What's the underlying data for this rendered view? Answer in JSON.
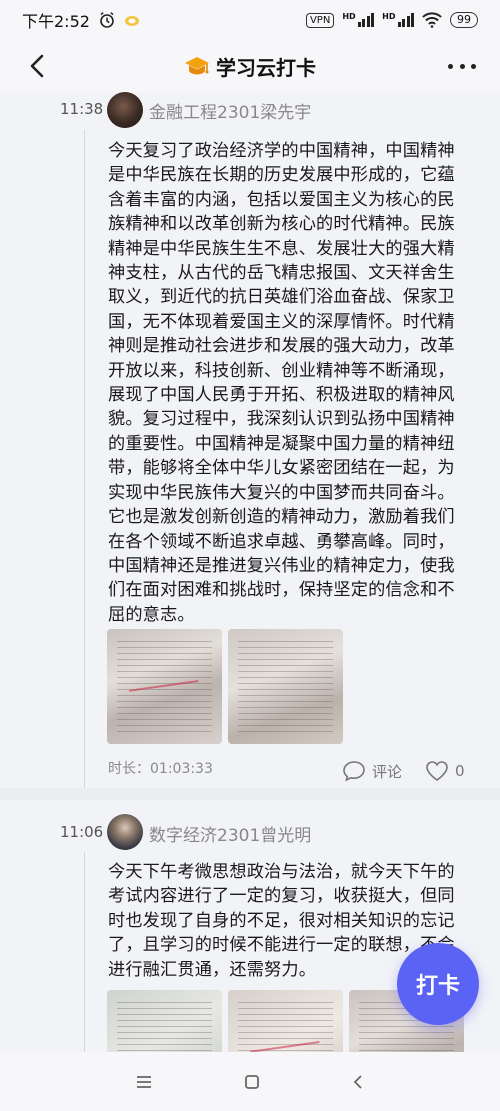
{
  "status_bar": {
    "time": "下午2:52",
    "vpn": "VPN",
    "hd1": "HD",
    "hd2": "HD",
    "battery": "99",
    "icons": [
      "alarm-icon",
      "app-badge-icon",
      "signal-icon",
      "wifi-icon",
      "battery-icon"
    ]
  },
  "header": {
    "title": "学习云打卡",
    "icons": [
      "back-icon",
      "mortarboard-icon",
      "more-icon"
    ]
  },
  "posts": [
    {
      "time": "11:38",
      "user": "金融工程2301梁先宇",
      "text": "今天复习了政治经济学的中国精神，中国精神是中华民族在长期的历史发展中形成的，它蕴含着丰富的内涵，包括以爱国主义为核心的民族精神和以改革创新为核心的时代精神。民族精神是中华民族生生不息、发展壮大的强大精神支柱，从古代的岳飞精忠报国、文天祥舍生取义，到近代的抗日英雄们浴血奋战、保家卫国，无不体现着爱国主义的深厚情怀。时代精神则是推动社会进步和发展的强大动力，改革开放以来，科技创新、创业精神等不断涌现，展现了中国人民勇于开拓、积极进取的精神风貌。复习过程中，我深刻认识到弘扬中国精神的重要性。中国精神是凝聚中国力量的精神纽带，能够将全体中华儿女紧密团结在一起，为实现中华民族伟大复兴的中国梦而共同奋斗。它也是激发创新创造的精神动力，激励着我们在各个领域不断追求卓越、勇攀高峰。同时，中国精神还是推进复兴伟业的精神定力，使我们在面对困难和挑战时，保持坚定的信念和不屈的意志。",
      "duration": "时长：01:03:33",
      "comment_label": "评论",
      "likes": "0"
    },
    {
      "time": "11:06",
      "user": "数字经济2301曾光明",
      "text": "今天下午考微思想政治与法治，就今天下午的考试内容进行了一定的复习，收获挺大，但同时也发现了自身的不足，很对相关知识的忘记了，且学习的时候不能进行一定的联想，不会进行融汇贯通，还需努力。"
    }
  ],
  "fab_label": "打卡",
  "system_nav": [
    "menu-icon",
    "home-icon",
    "back-nav-icon"
  ]
}
